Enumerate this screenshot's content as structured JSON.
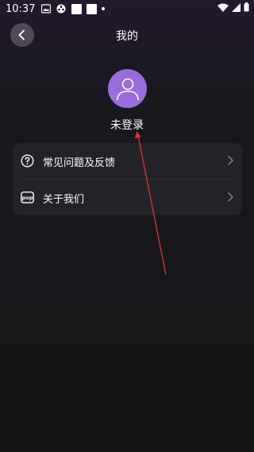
{
  "status_bar": {
    "time": "10:37"
  },
  "header": {
    "title": "我的"
  },
  "profile": {
    "login_status": "未登录"
  },
  "menu": {
    "items": [
      {
        "label": "常见问题及反馈",
        "icon": "help-circle-icon"
      },
      {
        "label": "关于我们",
        "icon": "pop-logo-icon"
      }
    ]
  },
  "pop_icon_text": "pop",
  "colors": {
    "background": "#18171b",
    "card": "#232228",
    "avatar": "#9a6ddf",
    "annotation_arrow": "#e0303a"
  }
}
